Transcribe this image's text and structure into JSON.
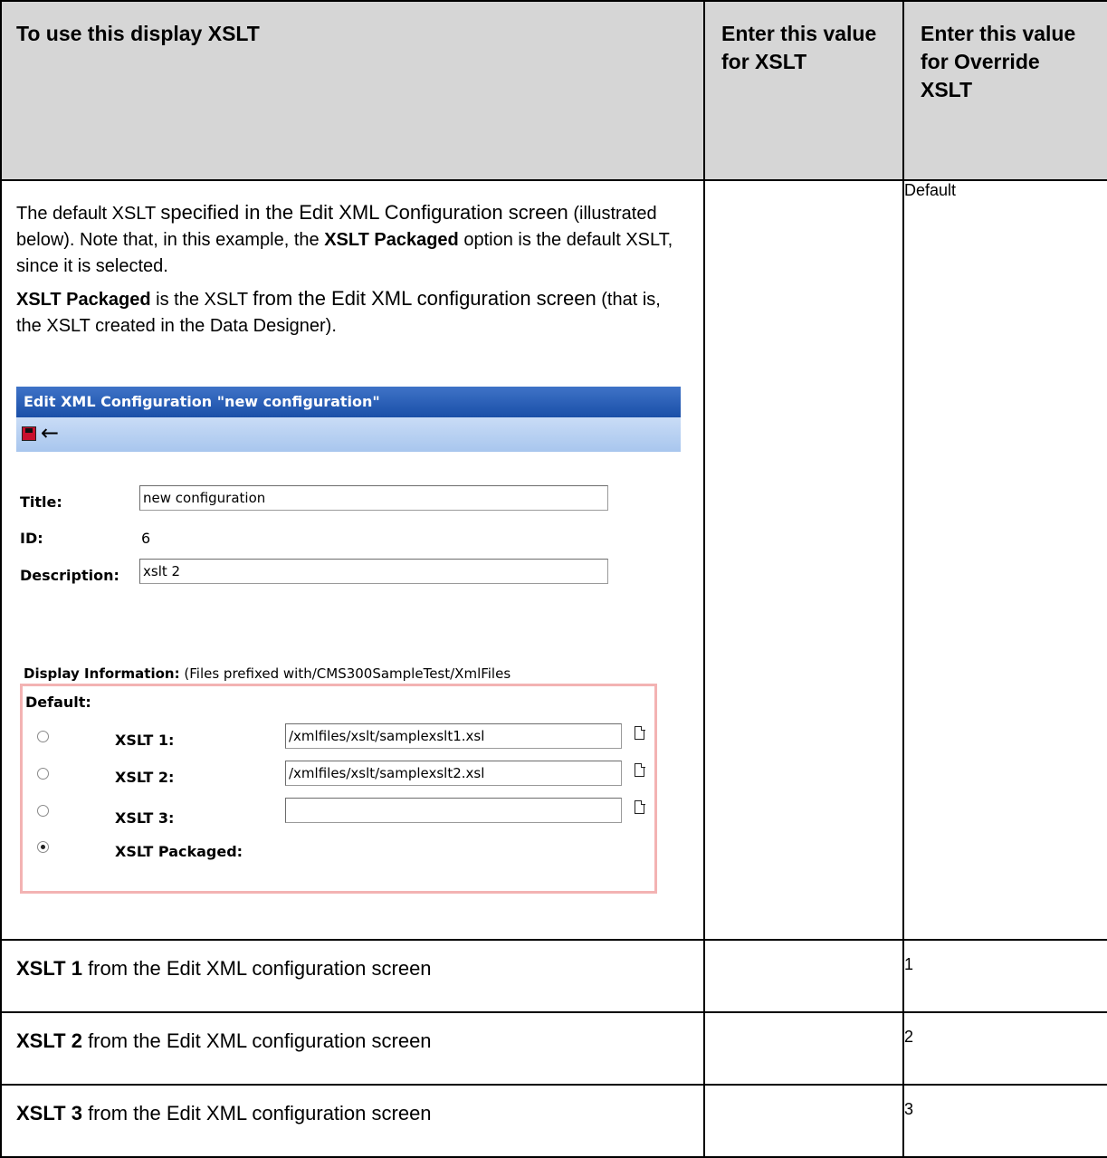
{
  "headers": {
    "col1": "To use this display XSLT",
    "col2": "Enter this value for XSLT",
    "col3": "Enter this value for Override XSLT"
  },
  "row1": {
    "para1_a": "The default XSLT ",
    "para1_b": "specified in the Edit XML Configuration screen",
    "para1_c": " (illustrated below). Note that, in this example, the ",
    "para1_bold": "XSLT Packaged",
    "para1_d": " option is the default XSLT, since it is selected.",
    "para2_bold": "XSLT Packaged",
    "para2_a": " is the XSLT ",
    "para2_b": "from the Edit XML configuration screen",
    "para2_c": " (that is, the XSLT created in the Data Designer).",
    "value_xslt": "",
    "value_override": "Default"
  },
  "screenshot": {
    "window_title": "Edit XML Configuration \"new configuration\"",
    "toolbar": {
      "save_icon": "save-icon",
      "back_icon": "back-arrow-icon"
    },
    "title_label": "Title:",
    "title_value": "new configuration",
    "id_label": "ID:",
    "id_value": "6",
    "description_label": "Description:",
    "description_value": "xslt 2",
    "display_info_label": "Display Information:",
    "display_info_note": "(Files prefixed with/CMS300SampleTest/XmlFiles",
    "default_label": "Default:",
    "xslt_options": [
      {
        "label": "XSLT 1:",
        "value": "/xmlfiles/xslt/samplexslt1.xsl",
        "selected": false
      },
      {
        "label": "XSLT 2:",
        "value": "/xmlfiles/xslt/samplexslt2.xsl",
        "selected": false
      },
      {
        "label": "XSLT 3:",
        "value": "",
        "selected": false
      },
      {
        "label": "XSLT Packaged:",
        "selected": true
      }
    ]
  },
  "rows": [
    {
      "bold": "XSLT 1",
      "text": " from the Edit XML configuration screen",
      "value_xslt": "",
      "value_override": "1"
    },
    {
      "bold": "XSLT 2",
      "text": " from the Edit XML configuration screen",
      "value_xslt": "",
      "value_override": "2"
    },
    {
      "bold": "XSLT 3",
      "text": " from the Edit XML configuration screen",
      "value_xslt": "",
      "value_override": "3"
    }
  ]
}
